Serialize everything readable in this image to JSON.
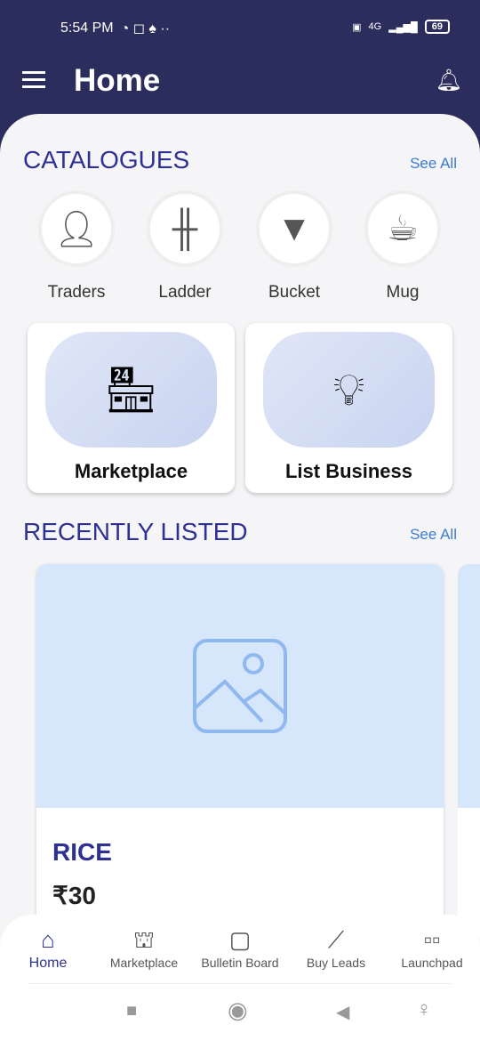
{
  "status": {
    "time": "5:54 PM",
    "network": "4G",
    "battery": "69"
  },
  "appbar": {
    "title": "Home"
  },
  "catalogues": {
    "heading": "CATALOGUES",
    "see_all": "See All",
    "items": [
      {
        "label": "Traders"
      },
      {
        "label": "Ladder"
      },
      {
        "label": "Bucket"
      },
      {
        "label": "Mug"
      }
    ]
  },
  "cards": [
    {
      "label": "Marketplace"
    },
    {
      "label": "List Business"
    }
  ],
  "recent": {
    "heading": "RECENTLY LISTED",
    "see_all": "See All",
    "items": [
      {
        "name": "RICE",
        "price": "₹30"
      }
    ]
  },
  "bottom_nav": [
    {
      "label": "Home",
      "icon": "home-icon"
    },
    {
      "label": "Marketplace",
      "icon": "store-icon"
    },
    {
      "label": "Bulletin Board",
      "icon": "easel-icon"
    },
    {
      "label": "Buy Leads",
      "icon": "trend-chart-icon"
    },
    {
      "label": "Launchpad",
      "icon": "grid-icon"
    }
  ],
  "colors": {
    "header": "#2b2d5c",
    "accent": "#2e3192",
    "link": "#3b7bd1",
    "placeholder": "#d6e6fb"
  }
}
